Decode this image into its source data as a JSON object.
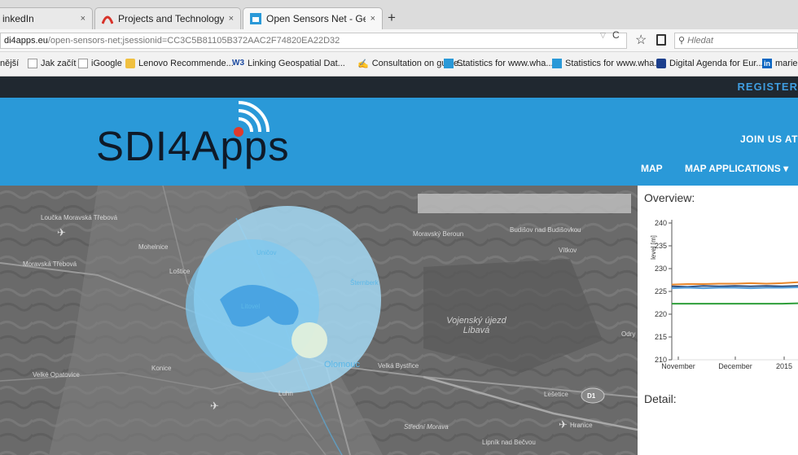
{
  "browser": {
    "tabs": [
      {
        "label": "inkedIn",
        "close": "×"
      },
      {
        "label": "Projects and Technology - ...",
        "close": "×"
      },
      {
        "label": "Open Sensors Net - Geopo...",
        "close": "×"
      }
    ],
    "new_tab": "+",
    "url_host": "di4apps.eu",
    "url_path": "/open-sensors-net;jsessionid=CC3C5B81105B372AAC2F74820EA22D32",
    "reload": "C",
    "search_placeholder": "Hledat",
    "bookmarks": [
      "nější",
      "Jak začít",
      "iGoogle",
      "Lenovo Recommende...",
      "Linking Geospatial Dat...",
      "Consultation on guide...",
      "Statistics for www.wha...",
      "Statistics for www.wha...",
      "Digital Agenda for Eur...",
      "marie"
    ]
  },
  "site": {
    "register": "REGISTER",
    "logo": "SDI4Apps",
    "join": "JOIN US AT",
    "nav": {
      "map": "MAP",
      "map_applications": "MAP APPLICATIONS ▾"
    }
  },
  "map": {
    "labels": [
      "Loučka Moravská Třebová",
      "Moravská Třebová",
      "Mohelnice",
      "Loštice",
      "Uničov",
      "Moravský Beroun",
      "Budišov nad Budišovkou",
      "Vítkov",
      "Šternberk",
      "Litovel",
      "Velké Opatovice",
      "Konice",
      "Olomouc",
      "Velká Bystřice",
      "Luhn",
      "Střední Morava",
      "Hranice",
      "Lipník nad Bečvou",
      "Odry",
      "Lešetice"
    ],
    "area_label": "Vojenský újezd Libavá",
    "road_shield": "D1"
  },
  "panel": {
    "overview": "Overview:",
    "detail": "Detail:"
  },
  "chart_data": {
    "type": "line",
    "ylabel": "level [m]",
    "ylim": [
      210,
      240
    ],
    "yticks": [
      240,
      235,
      230,
      225,
      220,
      215,
      210
    ],
    "xticks": [
      "November",
      "December",
      "2015"
    ],
    "series": [
      {
        "color": "#e8862a",
        "values": [
          226.5,
          226.6,
          226.6,
          226.7,
          226.7,
          226.8,
          226.7,
          226.8,
          227.0
        ]
      },
      {
        "color": "#2f4f7f",
        "values": [
          226.1,
          226.0,
          226.2,
          226.1,
          226.2,
          226.1,
          226.2,
          226.1,
          226.2
        ]
      },
      {
        "color": "#5aa3e0",
        "values": [
          225.7,
          225.8,
          225.7,
          225.8,
          225.8,
          225.7,
          225.8,
          225.8,
          225.9
        ]
      },
      {
        "color": "#2e9e3a",
        "values": [
          222.3,
          222.3,
          222.3,
          222.3,
          222.3,
          222.3,
          222.3,
          222.3,
          222.4
        ]
      }
    ]
  }
}
